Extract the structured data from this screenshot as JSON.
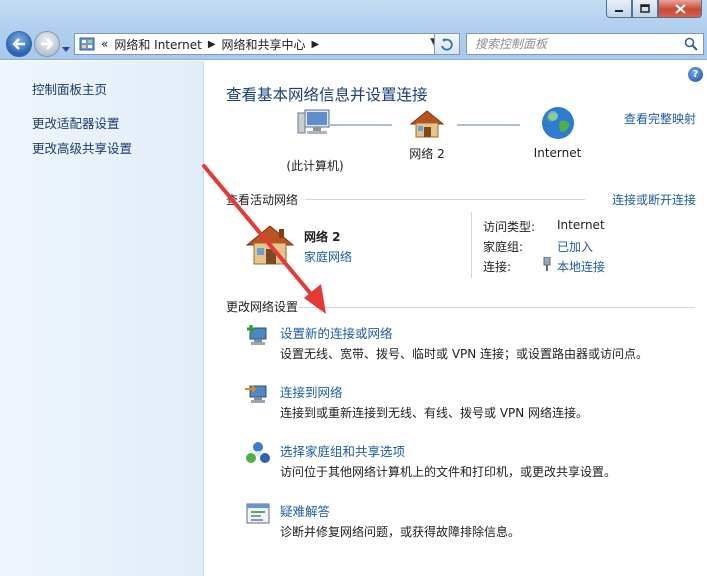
{
  "address_bar": {
    "overflow": "«",
    "crumbs": [
      "网络和 Internet",
      "网络和共享中心"
    ]
  },
  "search": {
    "placeholder": "搜索控制面板"
  },
  "left_nav": {
    "items": [
      "控制面板主页",
      "更改适配器设置",
      "更改高级共享设置"
    ]
  },
  "main": {
    "title": "查看基本网络信息并设置连接",
    "full_map_link": "查看完整映射",
    "map": {
      "this_computer": "(此计算机)",
      "network": "网络  2",
      "internet": "Internet"
    },
    "active_networks": {
      "title": "查看活动网络",
      "connect_link": "连接或断开连接",
      "name": "网络  2",
      "type": "家庭网络",
      "access_type_label": "访问类型:",
      "access_type_value": "Internet",
      "homegroup_label": "家庭组:",
      "homegroup_value": "已加入",
      "connection_label": "连接:",
      "connection_value": "本地连接"
    },
    "change_settings": {
      "title": "更改网络设置",
      "tasks": [
        {
          "link": "设置新的连接或网络",
          "desc": "设置无线、宽带、拨号、临时或 VPN 连接；或设置路由器或访问点。"
        },
        {
          "link": "连接到网络",
          "desc": "连接到或重新连接到无线、有线、拨号或 VPN 网络连接。"
        },
        {
          "link": "选择家庭组和共享选项",
          "desc": "访问位于其他网络计算机上的文件和打印机，或更改共享设置。"
        },
        {
          "link": "疑难解答",
          "desc": "诊断并修复网络问题，或获得故障排除信息。"
        }
      ]
    }
  },
  "colors": {
    "link": "#1c5ca8",
    "annotation_arrow": "#e53935",
    "heading": "#1a3e7a"
  }
}
